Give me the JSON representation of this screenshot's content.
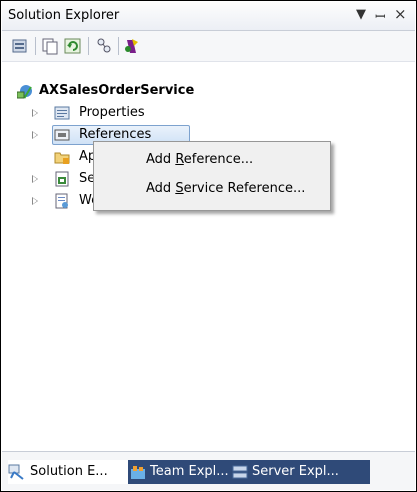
{
  "window": {
    "title": "Solution Explorer",
    "controls": {
      "dropdown": "▼",
      "pin": "ꟷ",
      "close": "×"
    }
  },
  "toolbar": {
    "icons": [
      "properties-icon",
      "show-all-files-icon",
      "refresh-icon",
      "view-class-diagram-icon",
      "nested-related-files-icon"
    ]
  },
  "tree": {
    "root": "AXSalesOrderService",
    "items": [
      {
        "label": "Properties",
        "icon": "properties-folder-icon",
        "expandable": true
      },
      {
        "label": "References",
        "icon": "references-folder-icon",
        "expandable": true,
        "selected": true
      },
      {
        "label": "App_Data",
        "icon": "folder-icon",
        "expandable": false
      },
      {
        "label": "Service.svc",
        "icon": "svc-file-icon",
        "expandable": true
      },
      {
        "label": "Web.config",
        "icon": "config-file-icon",
        "expandable": true
      }
    ]
  },
  "context_menu": {
    "items": [
      {
        "pre": "Add ",
        "accel": "R",
        "post": "eference..."
      },
      {
        "pre": "Add ",
        "accel": "S",
        "post": "ervice Reference..."
      }
    ]
  },
  "tabs": [
    {
      "label": "Solution E...",
      "active": true
    },
    {
      "label": "Team Expl...",
      "active": false
    },
    {
      "label": "Server Expl...",
      "active": false
    }
  ],
  "colors": {
    "accent": "#2f4a78",
    "selection": "#d0e2f6",
    "menu_bg": "#f0f0f0"
  }
}
